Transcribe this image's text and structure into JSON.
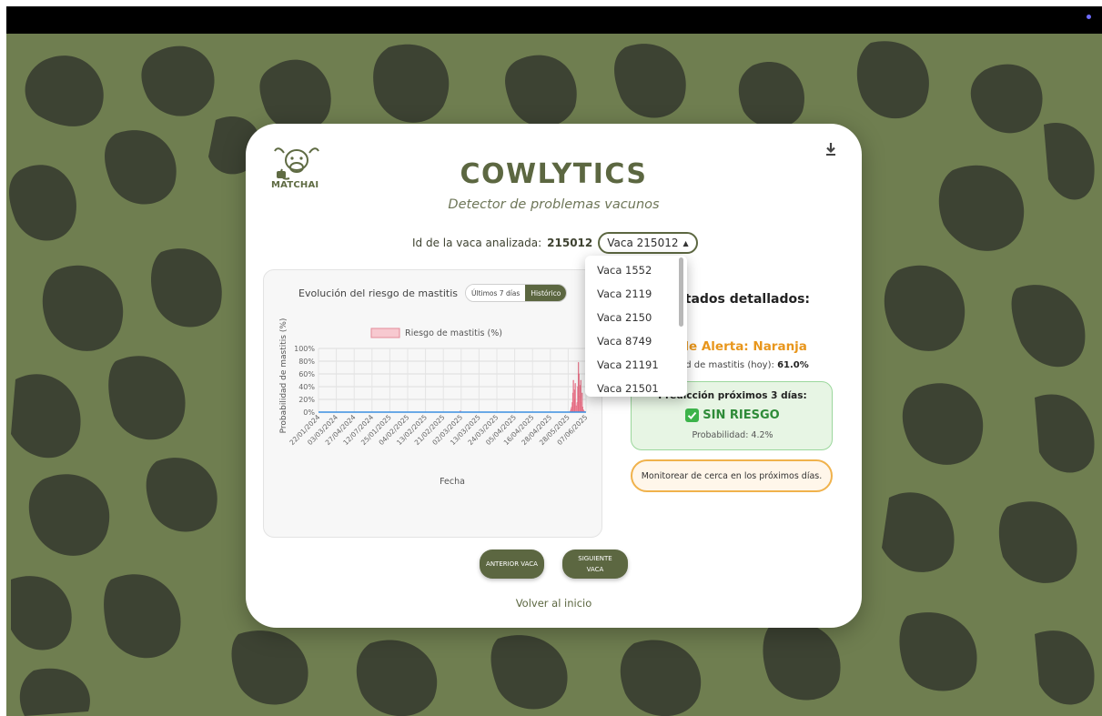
{
  "app": {
    "logo_text": "MATCHAI",
    "title": "COWLYTICS",
    "subtitle": "Detector de problemas vacunos"
  },
  "cow": {
    "id_label": "Id de la vaca analizada:",
    "id_value": "215012",
    "selected": "Vaca 215012",
    "options": [
      "Vaca 1552",
      "Vaca 2119",
      "Vaca 2150",
      "Vaca 8749",
      "Vaca 21191",
      "Vaca 21501"
    ]
  },
  "chart_panel": {
    "title": "Evolución del riesgo de mastitis",
    "toggle_week": "Últimos 7 días",
    "toggle_hist": "Histórico",
    "active_toggle": "Histórico"
  },
  "chart_data": {
    "type": "bar",
    "title": "",
    "legend": "Riesgo de mastitis (%)",
    "legend_position": "top",
    "xlabel": "Fecha",
    "ylabel": "Probabilidad de mastitis (%)",
    "ylim": [
      0,
      100
    ],
    "yticks": [
      "0%",
      "20%",
      "40%",
      "60%",
      "80%",
      "100%"
    ],
    "xticks": [
      "22/01/2024",
      "03/03/2024",
      "27/04/2024",
      "12/07/2024",
      "25/01/2025",
      "04/02/2025",
      "13/02/2025",
      "21/02/2025",
      "02/03/2025",
      "13/03/2025",
      "24/03/2025",
      "05/04/2025",
      "16/04/2025",
      "28/04/2025",
      "28/05/2025",
      "07/06/2025"
    ],
    "grid": true,
    "series": [
      {
        "name": "Riesgo de mastitis (%)",
        "color": "#f3a9b5",
        "values": [
          0,
          0,
          0,
          0,
          0,
          0,
          0,
          0,
          0,
          0,
          0,
          0,
          0,
          0,
          0,
          0,
          0,
          0,
          0,
          0,
          0,
          0,
          0,
          0,
          0,
          0,
          0,
          0,
          0,
          0,
          0,
          0,
          0,
          0,
          0,
          0,
          0,
          0,
          0,
          0,
          0,
          0,
          0,
          0,
          0,
          0,
          0,
          0,
          0,
          0,
          0,
          0,
          0,
          0,
          0,
          0,
          0,
          0,
          0,
          0,
          0,
          0,
          0,
          0,
          0,
          0,
          0,
          0,
          0,
          0,
          0,
          0,
          0,
          0,
          0,
          0,
          0,
          0,
          0,
          0,
          0,
          0,
          0,
          0,
          0,
          0,
          0,
          0,
          0,
          0,
          0,
          0,
          0,
          0,
          0,
          0,
          0,
          0,
          0,
          0,
          0,
          0,
          0,
          0,
          0,
          0,
          0,
          0,
          0,
          0,
          0,
          0,
          0,
          0,
          0,
          0,
          0,
          0,
          0,
          0,
          0,
          0,
          0,
          0,
          0,
          0,
          0,
          0,
          0,
          0,
          0,
          0,
          0,
          0,
          0,
          0,
          0,
          0,
          0,
          0,
          0,
          0,
          0,
          0,
          0,
          0,
          0,
          0,
          0,
          0,
          0,
          0,
          0,
          0,
          0,
          0,
          0,
          0,
          0,
          0,
          0,
          0,
          0,
          0,
          0,
          0,
          0,
          0,
          0,
          0,
          0,
          0,
          0,
          0,
          0,
          0,
          0,
          0,
          0,
          0,
          0,
          0,
          0,
          0,
          0,
          0,
          0,
          0,
          0,
          0,
          0,
          0,
          0,
          0,
          0,
          0,
          0,
          0,
          0,
          0,
          0,
          0,
          0,
          0,
          0,
          0,
          0,
          0,
          0,
          0,
          0,
          0,
          0,
          0,
          0,
          0,
          0,
          0,
          0,
          0,
          0,
          0,
          0,
          0,
          0,
          0,
          0,
          0,
          0,
          0,
          2,
          0,
          0,
          0,
          0,
          0,
          0,
          0,
          0,
          0,
          0,
          0,
          0,
          0,
          0,
          0,
          0,
          0,
          0,
          0,
          0,
          0,
          0,
          0,
          0,
          0,
          0,
          0,
          0,
          0,
          0,
          0,
          0,
          0,
          0,
          0,
          0,
          0,
          0,
          0,
          0,
          0,
          0,
          0,
          0,
          0,
          0,
          0,
          0,
          0,
          0,
          0,
          0,
          0,
          0,
          0,
          0,
          0,
          0,
          0,
          0,
          0,
          0,
          0,
          0,
          0,
          0,
          0,
          0,
          0,
          0,
          0,
          0,
          0,
          0,
          0,
          0,
          0,
          0,
          0,
          0,
          0,
          0,
          0,
          0,
          0,
          0,
          0,
          0,
          0,
          0,
          0,
          0,
          0,
          0,
          0,
          0,
          0,
          0,
          0,
          0,
          0,
          0,
          0,
          0,
          0,
          0,
          0,
          0,
          0,
          0,
          0,
          0,
          0,
          0,
          0,
          0,
          0,
          0,
          0,
          0,
          0,
          0,
          0,
          0,
          0,
          0,
          0,
          0,
          0,
          0,
          0,
          0,
          0,
          0,
          0,
          0,
          0,
          0,
          0,
          0,
          0,
          0,
          0,
          0,
          0,
          0,
          0,
          0,
          0,
          0,
          0,
          0,
          0,
          0,
          0,
          0,
          0,
          0,
          0,
          0,
          0,
          0,
          0,
          0,
          0,
          0,
          0,
          0,
          0,
          0,
          0,
          0,
          0,
          0,
          0,
          0,
          0,
          0,
          2,
          5,
          8,
          15,
          30,
          50,
          35,
          20,
          45,
          10,
          0,
          15,
          40,
          78,
          60,
          25,
          42,
          50,
          15,
          30,
          8,
          4,
          2,
          1,
          0,
          0
        ]
      }
    ],
    "line_color": "#3b8fe0"
  },
  "results": {
    "title": "ultados detallados:",
    "alert_level": "l de Alerta: Naranja",
    "prob_today_label": "idad de mastitis (hoy):",
    "prob_today_value": "61.0%"
  },
  "prediction": {
    "title": "Predicción próximos 3 días:",
    "status": "SIN RIESGO",
    "probability": "Probabilidad: 4.2%"
  },
  "monitor_note": "Monitorear de cerca en los próximos días.",
  "nav": {
    "prev": "ANTERIOR VACA",
    "next_line1": "SIGUIENTE",
    "next_line2": "VACA",
    "home": "Volver al inicio"
  },
  "colors": {
    "brand": "#5c6741",
    "background_pattern": "#6f7e50",
    "spots": "#3d4333",
    "alert_orange": "#e8961c",
    "safe_green": "#2e8b38"
  },
  "icons": {
    "download": "download-icon",
    "check": "check-icon",
    "select_arrow": "caret-up-icon",
    "logo": "cow-logo-icon"
  }
}
